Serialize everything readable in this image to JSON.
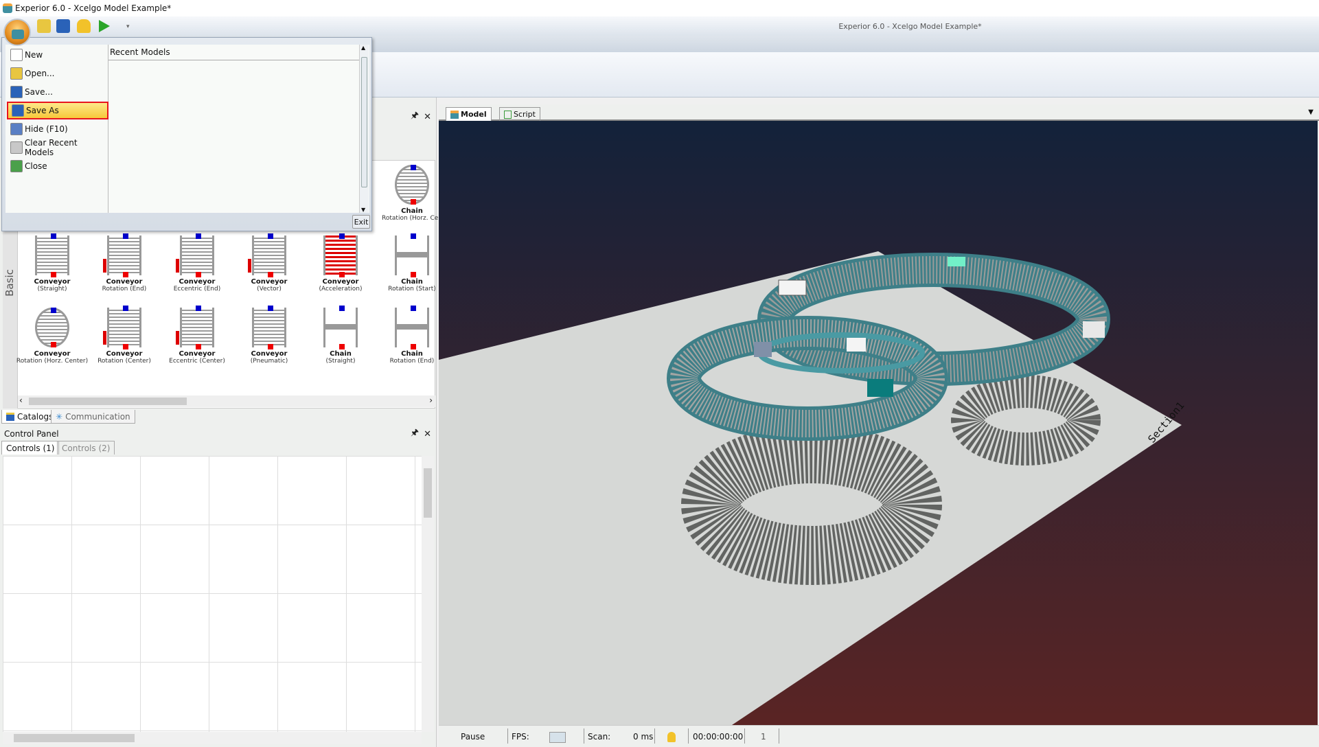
{
  "window": {
    "title": "Experior 6.0 - Xcelgo Model Example*"
  },
  "app_menu": {
    "items": [
      {
        "label": "New",
        "icon": "new-document-icon",
        "color": "#ffffff"
      },
      {
        "label": "Open...",
        "icon": "open-folder-icon",
        "color": "#e8c640"
      },
      {
        "label": "Save...",
        "icon": "save-icon",
        "color": "#2a62b8"
      },
      {
        "label": "Save As",
        "icon": "save-as-icon",
        "color": "#2a62b8",
        "highlighted": true
      },
      {
        "label": "Hide (F10)",
        "icon": "hide-icon",
        "color": "#5a7fc4"
      },
      {
        "label": "Clear Recent Models",
        "icon": "clear-recent-icon",
        "color": "#c8c8c8"
      },
      {
        "label": "Close",
        "icon": "close-door-icon",
        "color": "#4aa04a"
      }
    ],
    "recent_header": "Recent Models",
    "exit_label": "Exit"
  },
  "catalog": {
    "category": "Basic",
    "top_partial": {
      "name": "Chain",
      "sub": "Rotation (Horz. Cen"
    },
    "items": [
      {
        "name": "Conveyor",
        "sub": "(Straight)",
        "style": "plain"
      },
      {
        "name": "Conveyor",
        "sub": "Rotation (End)",
        "style": "side"
      },
      {
        "name": "Conveyor",
        "sub": "Eccentric (End)",
        "style": "side"
      },
      {
        "name": "Conveyor",
        "sub": "(Vector)",
        "style": "side"
      },
      {
        "name": "Conveyor",
        "sub": "(Acceleration)",
        "style": "accel"
      },
      {
        "name": "Chain",
        "sub": "Rotation (Start)",
        "style": "chain"
      },
      {
        "name": "Conveyor",
        "sub": "Rotation (Horz. Center)",
        "style": "round"
      },
      {
        "name": "Conveyor",
        "sub": "Rotation (Center)",
        "style": "side"
      },
      {
        "name": "Conveyor",
        "sub": "Eccentric (Center)",
        "style": "side"
      },
      {
        "name": "Conveyor",
        "sub": "(Pneumatic)",
        "style": "plain"
      },
      {
        "name": "Chain",
        "sub": "(Straight)",
        "style": "chain"
      },
      {
        "name": "Chain",
        "sub": "Rotation (End)",
        "style": "chain"
      }
    ]
  },
  "bottom_tabs": [
    {
      "label": "Catalogs",
      "active": true
    },
    {
      "label": "Communication",
      "active": false
    }
  ],
  "control_panel": {
    "title": "Control Panel",
    "tabs": [
      {
        "label": "Controls (1)",
        "active": true
      },
      {
        "label": "Controls (2)",
        "active": false
      }
    ]
  },
  "view_tabs": [
    {
      "label": "Model",
      "active": true
    },
    {
      "label": "Script",
      "active": false
    }
  ],
  "scene": {
    "section_label": "Section1",
    "sky_top": "#13223a",
    "sky_bottom": "#5a2424",
    "floor": "#d6d8d6",
    "track_edge": "#4a9aa3"
  },
  "status": {
    "state": "Pause",
    "fps_label": "FPS:",
    "scan_label": "Scan:",
    "scan_value": "0 ms",
    "time": "00:00:00:00",
    "count": "1"
  }
}
